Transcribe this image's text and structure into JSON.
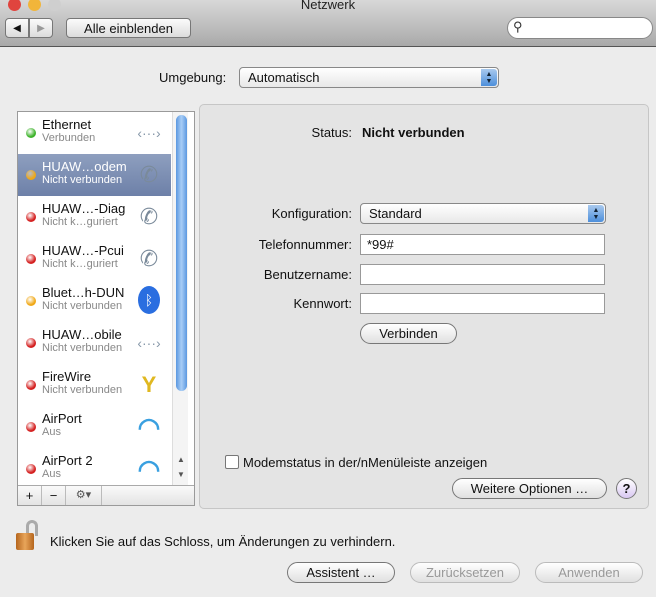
{
  "window": {
    "title": "Netzwerk"
  },
  "toolbar": {
    "back": "◀",
    "forward": "▶",
    "show_all": "Alle einblenden",
    "search_placeholder": ""
  },
  "location": {
    "label": "Umgebung:",
    "value": "Automatisch"
  },
  "services": [
    {
      "name": "Ethernet",
      "status": "Verbunden",
      "dot": "#3db32a",
      "icon": "ethernet"
    },
    {
      "name": "HUAW…odem",
      "status": "Nicht verbunden",
      "dot": "#f0a816",
      "icon": "phone"
    },
    {
      "name": "HUAW…-Diag",
      "status": "Nicht k…guriert",
      "dot": "#d41f1f",
      "icon": "phone"
    },
    {
      "name": "HUAW…-Pcui",
      "status": "Nicht k…guriert",
      "dot": "#d41f1f",
      "icon": "phone"
    },
    {
      "name": "Bluet…h-DUN",
      "status": "Nicht verbunden",
      "dot": "#f0a816",
      "icon": "bluetooth"
    },
    {
      "name": "HUAW…obile",
      "status": "Nicht verbunden",
      "dot": "#d41f1f",
      "icon": "ethernet"
    },
    {
      "name": "FireWire",
      "status": "Nicht verbunden",
      "dot": "#d41f1f",
      "icon": "firewire"
    },
    {
      "name": "AirPort",
      "status": "Aus",
      "dot": "#d41f1f",
      "icon": "wifi"
    },
    {
      "name": "AirPort 2",
      "status": "Aus",
      "dot": "#d41f1f",
      "icon": "wifi"
    }
  ],
  "sidebar_bar": {
    "add": "+",
    "remove": "−",
    "action": "⚙▾"
  },
  "detail": {
    "status_label": "Status:",
    "status_value": "Nicht verbunden",
    "config_label": "Konfiguration:",
    "config_value": "Standard",
    "phone_label": "Telefonnummer:",
    "phone_value": "*99#",
    "user_label": "Benutzername:",
    "user_value": "",
    "pass_label": "Kennwort:",
    "pass_value": "",
    "connect": "Verbinden",
    "modem_checkbox": "Modemstatus in der/nMenüleiste anzeigen",
    "modem_checked": false,
    "more_options": "Weitere Optionen …",
    "help": "?"
  },
  "footer": {
    "lock_text": "Klicken Sie auf das Schloss, um Änderungen zu verhindern.",
    "assistant": "Assistent …",
    "revert": "Zurücksetzen",
    "apply": "Anwenden"
  }
}
